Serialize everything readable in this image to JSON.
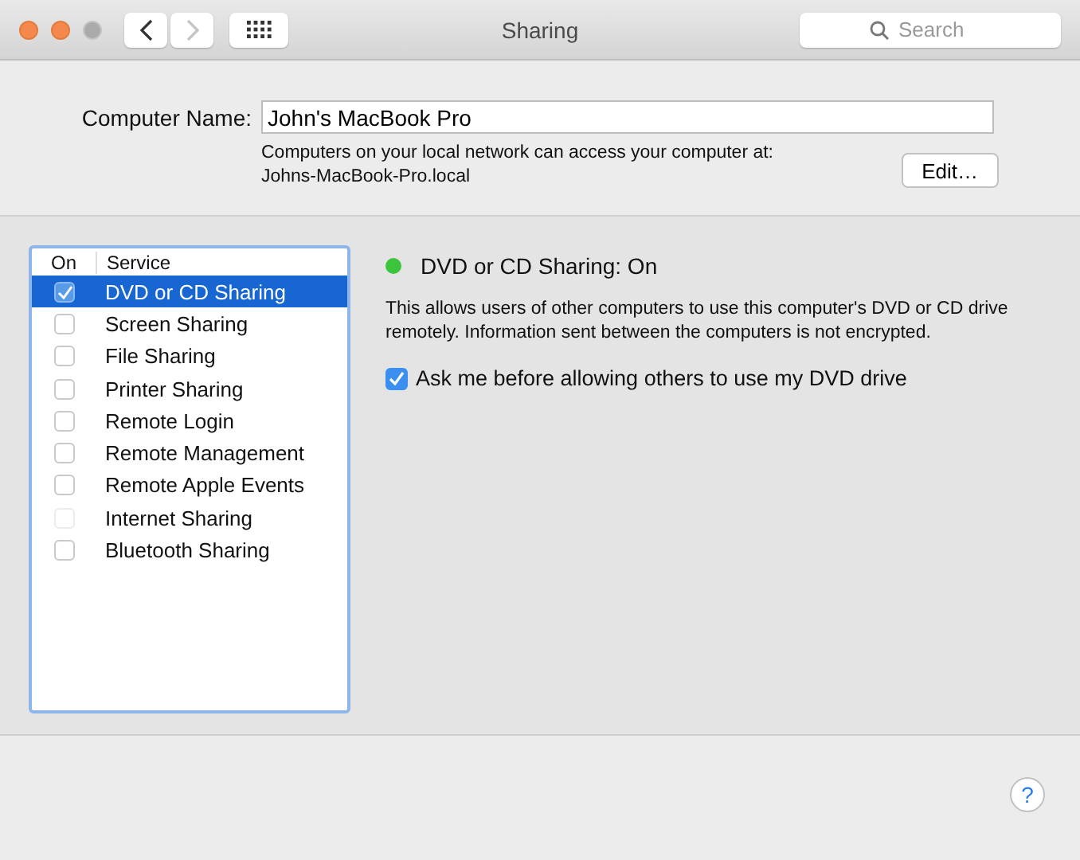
{
  "window": {
    "title": "Sharing",
    "back_disabled": false,
    "forward_disabled": true
  },
  "search": {
    "placeholder": "Search"
  },
  "computer_name": {
    "label": "Computer Name:",
    "value": "John's MacBook Pro",
    "note": "Computers on your local network can access your computer at:",
    "address": "Johns-MacBook-Pro.local",
    "edit_button": "Edit…"
  },
  "services": {
    "columns": [
      "On",
      "Service"
    ],
    "rows": [
      {
        "name": "DVD or CD Sharing",
        "checked": true,
        "selected": true,
        "disabled": false
      },
      {
        "name": "Screen Sharing",
        "checked": false,
        "selected": false,
        "disabled": false
      },
      {
        "name": "File Sharing",
        "checked": false,
        "selected": false,
        "disabled": false
      },
      {
        "name": "Printer Sharing",
        "checked": false,
        "selected": false,
        "disabled": false
      },
      {
        "name": "Remote Login",
        "checked": false,
        "selected": false,
        "disabled": false
      },
      {
        "name": "Remote Management",
        "checked": false,
        "selected": false,
        "disabled": false
      },
      {
        "name": "Remote Apple Events",
        "checked": false,
        "selected": false,
        "disabled": false
      },
      {
        "name": "Internet Sharing",
        "checked": false,
        "selected": false,
        "disabled": true
      },
      {
        "name": "Bluetooth Sharing",
        "checked": false,
        "selected": false,
        "disabled": false
      }
    ]
  },
  "detail": {
    "status": "DVD or CD Sharing: On",
    "on": true,
    "description": "This allows users of other computers to use this computer's DVD or CD drive remotely. Information sent between the computers is not encrypted.",
    "option": {
      "label": "Ask me before allowing others to use my DVD drive",
      "checked": true
    }
  },
  "help_button": "?"
}
